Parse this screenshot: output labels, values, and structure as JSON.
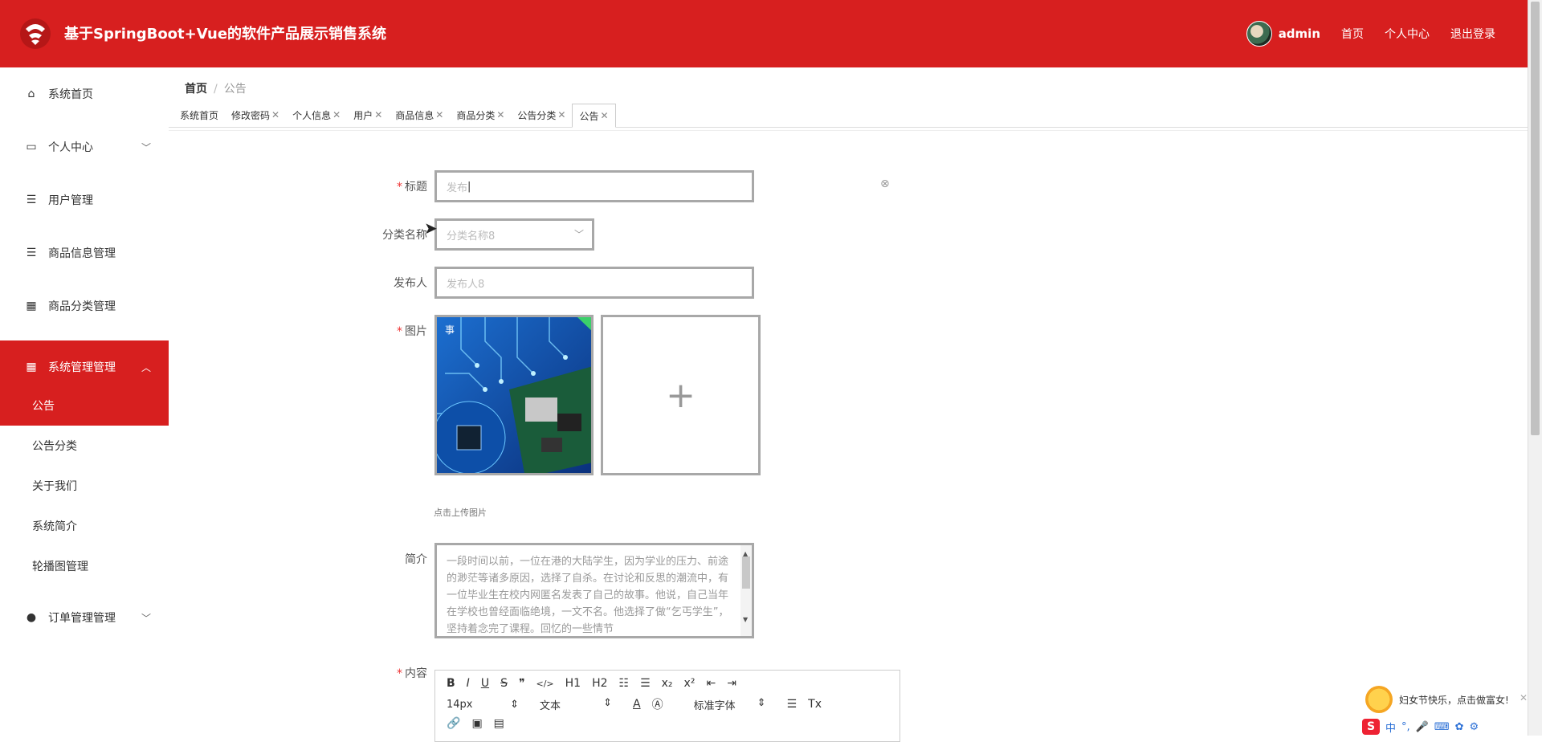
{
  "header": {
    "title": "基于SpringBoot+Vue的软件产品展示销售系统",
    "user": "admin",
    "links": [
      "首页",
      "个人中心",
      "退出登录"
    ]
  },
  "sidebar": {
    "items": [
      {
        "label": "系统首页",
        "icon": "home-icon"
      },
      {
        "label": "个人中心",
        "icon": "card-icon"
      },
      {
        "label": "用户管理",
        "icon": "list-icon"
      },
      {
        "label": "商品信息管理",
        "icon": "list-icon"
      },
      {
        "label": "商品分类管理",
        "icon": "grid-icon"
      },
      {
        "label": "系统管理管理",
        "icon": "grid-icon"
      },
      {
        "label": "订单管理管理",
        "icon": "bulb-icon"
      }
    ],
    "subitems": [
      "公告",
      "公告分类",
      "关于我们",
      "系统简介",
      "轮播图管理"
    ]
  },
  "breadcrumb": {
    "home": "首页",
    "current": "公告"
  },
  "tags": [
    "系统首页",
    "修改密码",
    "个人信息",
    "用户",
    "商品信息",
    "商品分类",
    "公告分类",
    "公告"
  ],
  "form": {
    "title_label": "标题",
    "title_value": "发布",
    "category_label": "分类名称",
    "category_placeholder": "分类名称8",
    "publisher_label": "发布人",
    "publisher_placeholder": "发布人8",
    "image_label": "图片",
    "upload_tip": "点击上传图片",
    "intro_label": "简介",
    "intro_text": "一段时间以前，一位在港的大陆学生，因为学业的压力、前途的渺茫等诸多原因，选择了自杀。在讨论和反思的潮流中，有一位毕业生在校内网匿名发表了自己的故事。他说，自己当年在学校也曾经面临绝境，一文不名。他选择了做“乞丐学生”，坚持着念完了课程。回忆的一些情节",
    "content_label": "内容"
  },
  "editor": {
    "row1": [
      "B",
      "I",
      "U",
      "S",
      "❞",
      "</>",
      "H1",
      "H2",
      "ol",
      "ul",
      "x₂",
      "x²",
      "outdent",
      "indent"
    ],
    "size": "14px",
    "block": "文本",
    "font": "标准字体"
  },
  "promo": {
    "text": "妇女节快乐，点击做富女!"
  },
  "ime": {
    "label": "中"
  },
  "colors": {
    "brand": "#d71f1f"
  }
}
